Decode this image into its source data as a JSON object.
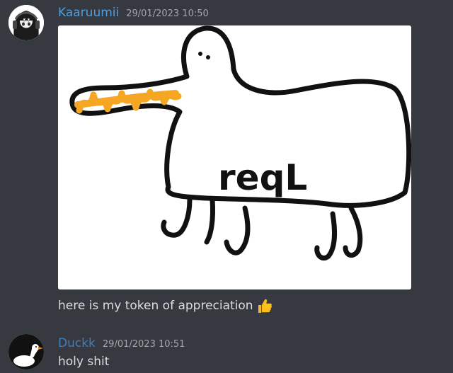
{
  "messages": [
    {
      "author": "Kaaruumii",
      "timestamp": "29/01/2023 10:50",
      "avatar_icon": "anime-girl-avatar-icon",
      "attachment": {
        "drawing_text": "reqL",
        "icon": "duck-drawing-image"
      },
      "text": "here is my token of appreciation",
      "emoji": "thumbs-up-emoji"
    },
    {
      "author": "Duckk",
      "timestamp": "29/01/2023 10:51",
      "avatar_icon": "duck-avatar-icon",
      "text": "holy shit"
    }
  ],
  "colors": {
    "background": "#36393f",
    "username_1": "#4f9ed9",
    "username_2": "#3e7fbd",
    "timestamp": "#a3a6aa",
    "text": "#dcddde",
    "beak_orange": "#f5a623"
  }
}
